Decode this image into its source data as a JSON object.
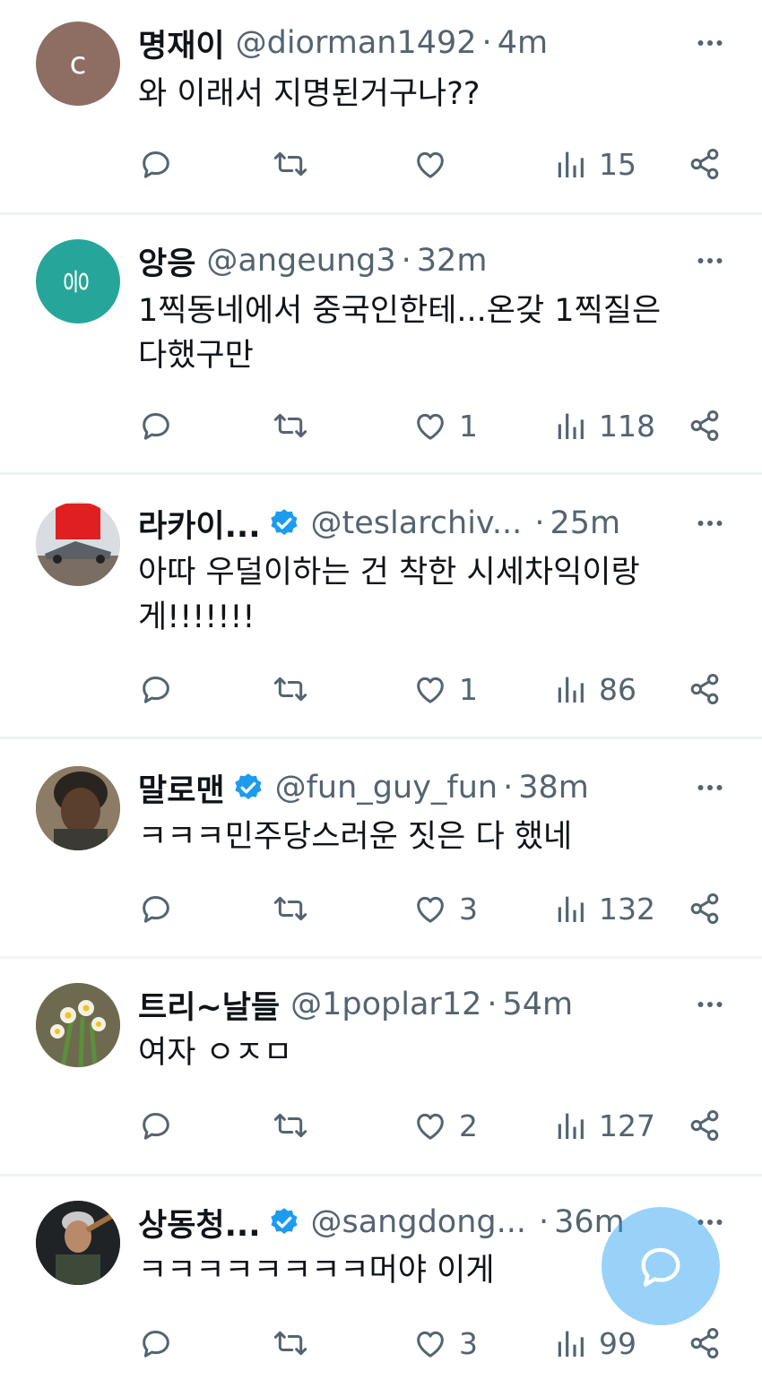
{
  "colors": {
    "accent": "#1d9bf0",
    "muted": "#536471",
    "text": "#0f1419",
    "divider": "#eff3f4"
  },
  "tweets": [
    {
      "avatar_letter": "c",
      "avatar_color": "#8e6e63",
      "name": "명재이",
      "verified": false,
      "handle": "@diorman1492",
      "time": "4m",
      "text": [
        "와 이래서 지명된거구나??"
      ],
      "replies": "",
      "retweets": "",
      "likes": "",
      "views": "15"
    },
    {
      "avatar_letter": "응",
      "avatar_color": "#26a69a",
      "name": "앙응",
      "verified": false,
      "handle": "@angeung3",
      "time": "32m",
      "text": [
        "1찍동네에서 중국인한테...온갖 1찍질은",
        "다했구만"
      ],
      "replies": "",
      "retweets": "",
      "likes": "1",
      "views": "118"
    },
    {
      "avatar_letter": "",
      "avatar_color": "#c7ccd1",
      "name": "라카이...",
      "verified": true,
      "handle": "@teslarchiv...",
      "time": "25m",
      "text": [
        "아따 우덜이하는 건 착한 시세차익이랑",
        "게!!!!!!!"
      ],
      "replies": "",
      "retweets": "",
      "likes": "1",
      "views": "86"
    },
    {
      "avatar_letter": "",
      "avatar_color": "#6b5a45",
      "name": "말로맨",
      "verified": true,
      "handle": "@fun_guy_fun",
      "time": "38m",
      "text": [
        "ㅋㅋㅋ민주당스러운 짓은 다 했네"
      ],
      "replies": "",
      "retweets": "",
      "likes": "3",
      "views": "132"
    },
    {
      "avatar_letter": "",
      "avatar_color": "#7a8a55",
      "name": "트리~날들",
      "verified": false,
      "handle": "@1poplar12",
      "time": "54m",
      "text": [
        "여자 ㅇㅈㅁ"
      ],
      "replies": "",
      "retweets": "",
      "likes": "2",
      "views": "127"
    },
    {
      "avatar_letter": "",
      "avatar_color": "#3a3a3a",
      "name": "상동청...",
      "verified": true,
      "handle": "@sangdong...",
      "time": "36m",
      "text": [
        "ㅋㅋㅋㅋㅋㅋㅋㅋ머야 이게"
      ],
      "replies": "",
      "retweets": "",
      "likes": "3",
      "views": "99"
    }
  ],
  "icons": {
    "reply": "reply-icon",
    "retweet": "retweet-icon",
    "like": "heart-icon",
    "views": "views-icon",
    "share": "share-icon",
    "more": "more-icon",
    "compose": "compose-reply-icon"
  }
}
